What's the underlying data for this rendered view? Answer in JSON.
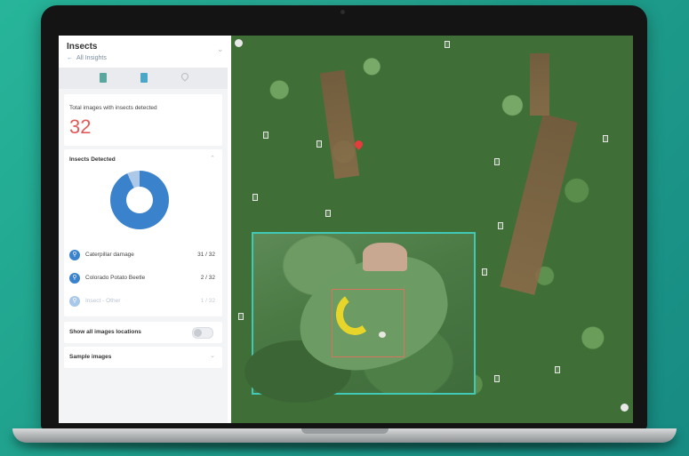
{
  "app": {
    "panel_title": "Insects",
    "panel_subtitle": "",
    "back_link": "All Insights",
    "menu_glyph": "⌄"
  },
  "tabs": [
    {
      "name": "report-tab",
      "icon": "document-icon"
    },
    {
      "name": "insights-tab",
      "icon": "document-icon"
    },
    {
      "name": "location-tab",
      "icon": "map-pin-icon"
    }
  ],
  "summary": {
    "label": "Total images with insects detected",
    "count": "32",
    "unit": ""
  },
  "detected": {
    "title": "Insects Detected",
    "chevron": "⌃",
    "donut_colors": {
      "primary": "#3b82cc",
      "secondary": "#aec9e8"
    },
    "donut_share_primary": 0.93,
    "items": [
      {
        "label": "Caterpillar damage",
        "count": "31 / 32",
        "icon": "bug-icon",
        "faint": false
      },
      {
        "label": "Colorado Potato Beetle",
        "count": "2 / 32",
        "icon": "bug-icon",
        "faint": false
      },
      {
        "label": "Insect - Other",
        "count": "1 / 32",
        "icon": "bug-icon",
        "faint": true
      }
    ]
  },
  "locations": {
    "label": "Show all images locations",
    "enabled": false
  },
  "samples": {
    "title": "Sample images",
    "chevron": "⌄"
  },
  "colors": {
    "accent": "#41c9b5",
    "highlight": "#e35a5a",
    "marker": "#e43b3b"
  }
}
